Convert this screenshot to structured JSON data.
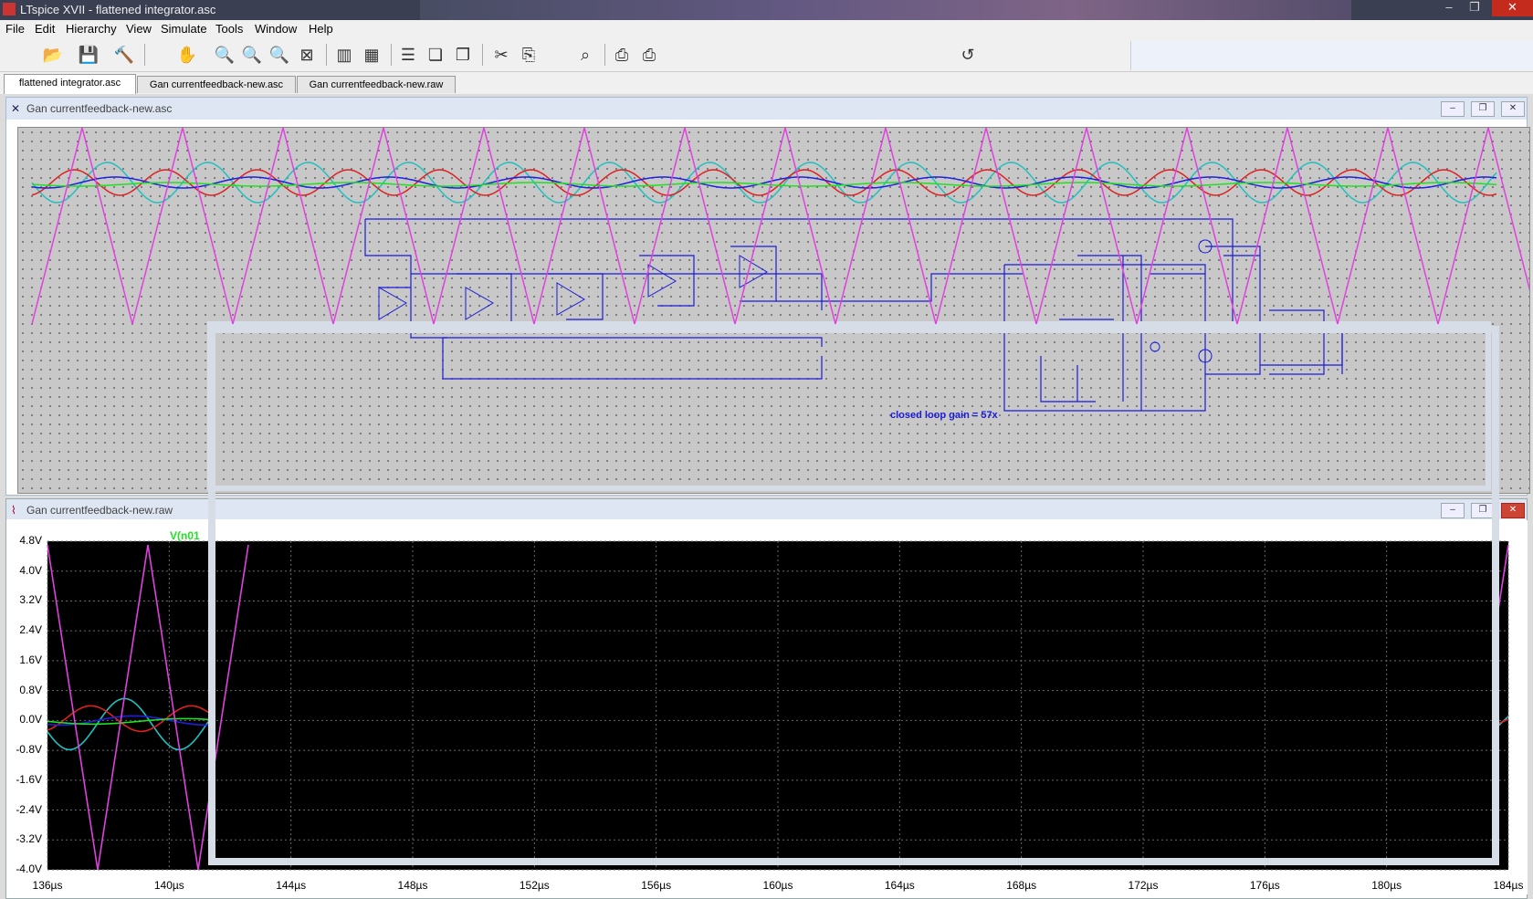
{
  "app": {
    "title": "LTspice XVII - flattened integrator.asc"
  },
  "menu": [
    "File",
    "Edit",
    "Hierarchy",
    "View",
    "Simulate",
    "Tools",
    "Window",
    "Help"
  ],
  "tabs": [
    {
      "label": "flattened integrator.asc",
      "active": true
    },
    {
      "label": "Gan currentfeedback-new.asc",
      "active": false
    },
    {
      "label": "Gan currentfeedback-new.raw",
      "active": false
    }
  ],
  "schematic_window": {
    "title": "Gan currentfeedback-new.asc",
    "annotation": "closed loop gain = 57x"
  },
  "waveform_window": {
    "title": "Gan currentfeedback-new.raw",
    "trace_label": "V(n01",
    "y_ticks": [
      "4.8V",
      "4.0V",
      "3.2V",
      "2.4V",
      "1.6V",
      "0.8V",
      "0.0V",
      "-0.8V",
      "-1.6V",
      "-2.4V",
      "-3.2V",
      "-4.0V"
    ],
    "x_ticks": [
      "136µs",
      "140µs",
      "144µs",
      "148µs",
      "152µs",
      "156µs",
      "160µs",
      "164µs",
      "168µs",
      "172µs",
      "176µs",
      "180µs",
      "184µs"
    ]
  },
  "colors": {
    "trace_magenta": "#e040e0",
    "trace_red": "#e02020",
    "trace_blue": "#2020e0",
    "trace_cyan": "#20c0c0",
    "trace_green": "#20e020",
    "schematic_wire": "#1a1ad8"
  }
}
